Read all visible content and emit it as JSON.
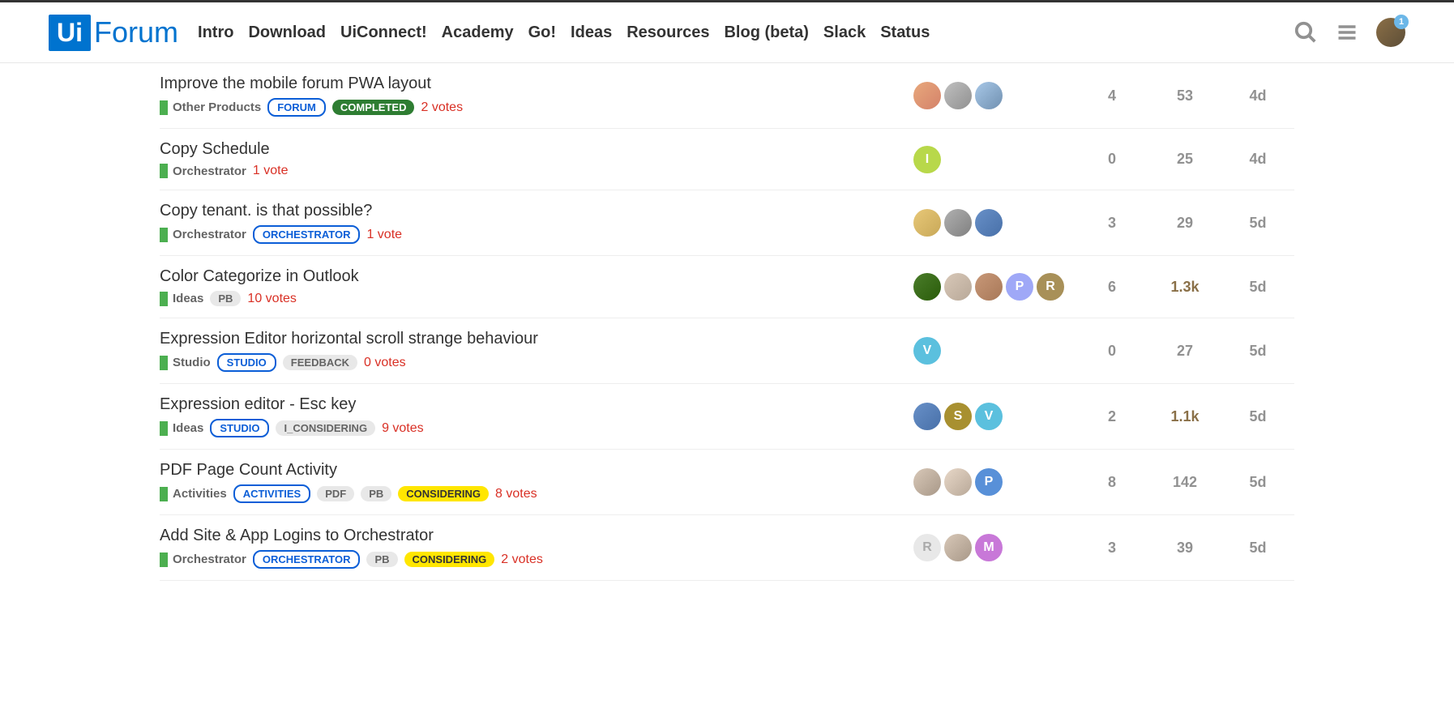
{
  "logo": {
    "box": "Ui",
    "text": "Forum"
  },
  "nav": [
    "Intro",
    "Download",
    "UiConnect!",
    "Academy",
    "Go!",
    "Ideas",
    "Resources",
    "Blog (beta)",
    "Slack",
    "Status"
  ],
  "notif_count": "1",
  "topics": [
    {
      "title": "Improve the mobile forum PWA layout",
      "category": "Other Products",
      "tags": [
        {
          "text": "FORUM",
          "style": "blue"
        },
        {
          "text": "COMPLETED",
          "style": "green"
        }
      ],
      "votes": "2 votes",
      "posters": [
        {
          "type": "img",
          "bg": "linear-gradient(135deg,#e8a87c,#d4826a)"
        },
        {
          "type": "img",
          "bg": "linear-gradient(135deg,#c0c0c0,#909090)"
        },
        {
          "type": "img",
          "bg": "linear-gradient(135deg,#a8c8e8,#7090b0)"
        }
      ],
      "replies": "4",
      "views": "53",
      "views_hot": false,
      "activity": "4d"
    },
    {
      "title": "Copy Schedule",
      "category": "Orchestrator",
      "tags": [],
      "votes": "1 vote",
      "posters": [
        {
          "type": "letter",
          "letter": "I",
          "bg": "#b8d84a"
        }
      ],
      "replies": "0",
      "views": "25",
      "views_hot": false,
      "activity": "4d"
    },
    {
      "title": "Copy tenant. is that possible?",
      "category": "Orchestrator",
      "tags": [
        {
          "text": "ORCHESTRATOR",
          "style": "blue"
        }
      ],
      "votes": "1 vote",
      "posters": [
        {
          "type": "img",
          "bg": "linear-gradient(135deg,#e8c878,#c8a858)"
        },
        {
          "type": "img",
          "bg": "linear-gradient(135deg,#b0b0b0,#808080)"
        },
        {
          "type": "img",
          "bg": "linear-gradient(135deg,#6890c8,#4870a8)"
        }
      ],
      "replies": "3",
      "views": "29",
      "views_hot": false,
      "activity": "5d"
    },
    {
      "title": "Color Categorize in Outlook",
      "category": "Ideas",
      "tags": [
        {
          "text": "PB",
          "style": "grey"
        }
      ],
      "votes": "10 votes",
      "posters": [
        {
          "type": "img",
          "bg": "linear-gradient(135deg,#4a7c2a,#2a5c0a)"
        },
        {
          "type": "img",
          "bg": "linear-gradient(135deg,#d8c8b8,#b8a898)"
        },
        {
          "type": "img",
          "bg": "linear-gradient(135deg,#c89878,#a87858)"
        },
        {
          "type": "letter",
          "letter": "P",
          "bg": "#9fa8f7"
        },
        {
          "type": "letter",
          "letter": "R",
          "bg": "#a89058"
        }
      ],
      "replies": "6",
      "views": "1.3k",
      "views_hot": true,
      "activity": "5d"
    },
    {
      "title": "Expression Editor horizontal scroll strange behaviour",
      "category": "Studio",
      "tags": [
        {
          "text": "STUDIO",
          "style": "blue"
        },
        {
          "text": "FEEDBACK",
          "style": "grey"
        }
      ],
      "votes": "0 votes",
      "posters": [
        {
          "type": "letter",
          "letter": "V",
          "bg": "#5bc0de"
        }
      ],
      "replies": "0",
      "views": "27",
      "views_hot": false,
      "activity": "5d"
    },
    {
      "title": "Expression editor - Esc key",
      "category": "Ideas",
      "tags": [
        {
          "text": "STUDIO",
          "style": "blue"
        },
        {
          "text": "I_CONSIDERING",
          "style": "grey"
        }
      ],
      "votes": "9 votes",
      "posters": [
        {
          "type": "img",
          "bg": "linear-gradient(135deg,#6890c8,#4870a8)"
        },
        {
          "type": "letter",
          "letter": "S",
          "bg": "#a89030"
        },
        {
          "type": "letter",
          "letter": "V",
          "bg": "#5bc0de"
        }
      ],
      "replies": "2",
      "views": "1.1k",
      "views_hot": true,
      "activity": "5d"
    },
    {
      "title": "PDF Page Count Activity",
      "category": "Activities",
      "tags": [
        {
          "text": "ACTIVITIES",
          "style": "blue"
        },
        {
          "text": "PDF",
          "style": "grey"
        },
        {
          "text": "PB",
          "style": "grey"
        },
        {
          "text": "CONSIDERING",
          "style": "yellow"
        }
      ],
      "votes": "8 votes",
      "posters": [
        {
          "type": "img",
          "bg": "linear-gradient(135deg,#d8c8b8,#a89888)"
        },
        {
          "type": "img",
          "bg": "linear-gradient(135deg,#e8d8c8,#b8a898)"
        },
        {
          "type": "letter",
          "letter": "P",
          "bg": "#5890d8"
        }
      ],
      "replies": "8",
      "views": "142",
      "views_hot": false,
      "activity": "5d"
    },
    {
      "title": "Add Site & App Logins to Orchestrator",
      "category": "Orchestrator",
      "tags": [
        {
          "text": "ORCHESTRATOR",
          "style": "blue"
        },
        {
          "text": "PB",
          "style": "grey"
        },
        {
          "text": "CONSIDERING",
          "style": "yellow"
        }
      ],
      "votes": "2 votes",
      "posters": [
        {
          "type": "letter",
          "letter": "R",
          "bg": "#e8e8e8",
          "fg": "#aaa"
        },
        {
          "type": "img",
          "bg": "linear-gradient(135deg,#d8c8b8,#a89888)"
        },
        {
          "type": "letter",
          "letter": "M",
          "bg": "#c878d8"
        }
      ],
      "replies": "3",
      "views": "39",
      "views_hot": false,
      "activity": "5d"
    }
  ]
}
